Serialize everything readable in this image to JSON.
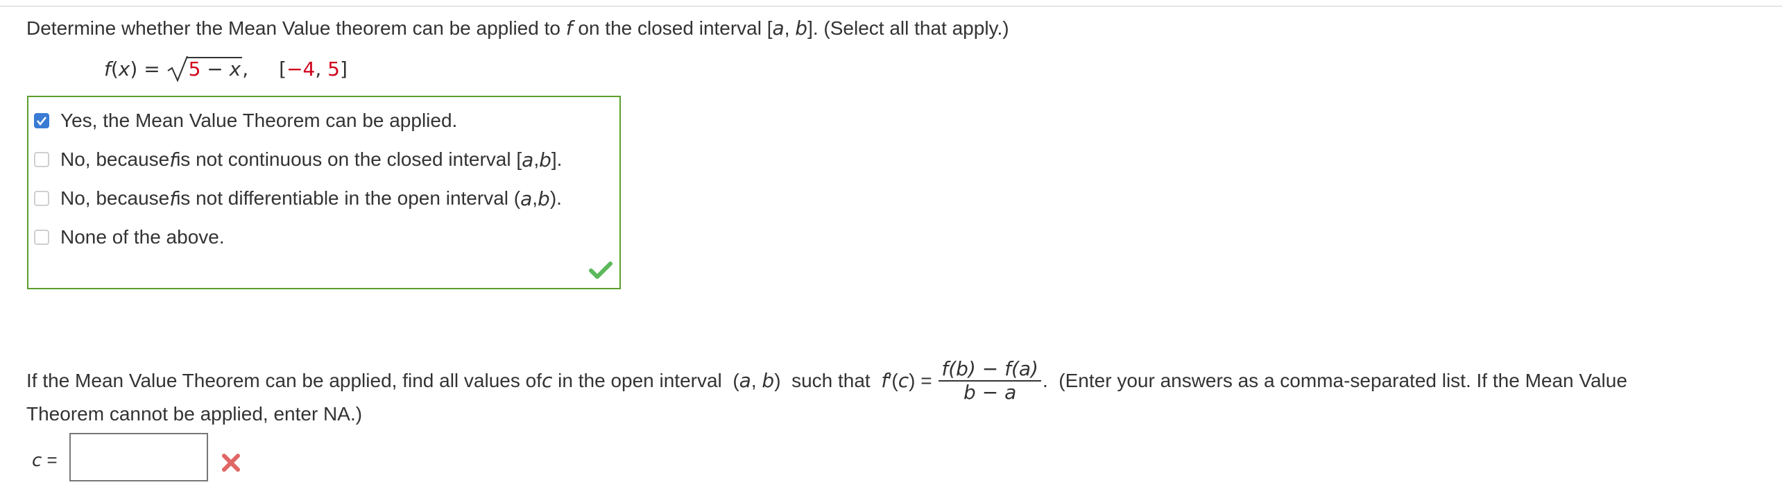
{
  "question1": {
    "prompt_a": "Determine whether the Mean Value theorem can be applied to ",
    "prompt_f": "f",
    "prompt_b": " on the closed interval  [",
    "prompt_a_var": "a",
    "prompt_comma": ", ",
    "prompt_b_var": "b",
    "prompt_c": "].  (Select all that apply.)",
    "function": {
      "lhs_f": "f",
      "lhs_x": "x",
      "lhs_rest": ") = ",
      "radicand_num": "5",
      "radicand_rest": " − ",
      "radicand_x": "x",
      "after": ",",
      "interval_open": "[",
      "interval_left": "−4",
      "interval_sep": ", ",
      "interval_right": "5",
      "interval_close": "]"
    },
    "options": [
      {
        "checked": true,
        "t1": "Yes, the Mean Value Theorem can be applied.",
        "tf": "",
        "t2": "",
        "ta": "",
        "tsep": "",
        "tb": "",
        "tend": ""
      },
      {
        "checked": false,
        "t1": "No, because ",
        "tf": "f",
        "t2": " is not continuous on the closed interval [",
        "ta": "a",
        "tsep": ", ",
        "tb": "b",
        "tend": "]."
      },
      {
        "checked": false,
        "t1": "No, because ",
        "tf": "f",
        "t2": " is not differentiable in the open interval (",
        "ta": "a",
        "tsep": ", ",
        "tb": "b",
        "tend": ")."
      },
      {
        "checked": false,
        "t1": "None of the above.",
        "tf": "",
        "t2": "",
        "ta": "",
        "tsep": "",
        "tb": "",
        "tend": ""
      }
    ],
    "status_icon": "green-check-icon",
    "status_color": "#5cb85c"
  },
  "question2": {
    "p1": "If the Mean Value Theorem can be applied, find all values of ",
    "p1_c": "c",
    "p1_b": " in the open interval  (",
    "p1_a": "a",
    "p1_sep": ", ",
    "p1_bb": "b",
    "p1_close": ")  such that  ",
    "deriv_f": "f",
    "deriv_rest": " ′(",
    "deriv_c": "c",
    "deriv_close": ") = ",
    "frac_num": "f(b) − f(a)",
    "frac_den": "b − a",
    "p2": ".  (Enter your answers as a comma-separated list. If the Mean Value",
    "p3": "Theorem cannot be applied, enter NA.)",
    "input_label_c": "c",
    "input_label_eq": " =",
    "input_value": "",
    "status_icon": "red-x-icon",
    "status_color": "#e06666"
  },
  "colors": {
    "answer_box_border": "#5a9e2d",
    "checkbox_checked": "#3a7bd5",
    "highlight_red": "#d0021b"
  }
}
